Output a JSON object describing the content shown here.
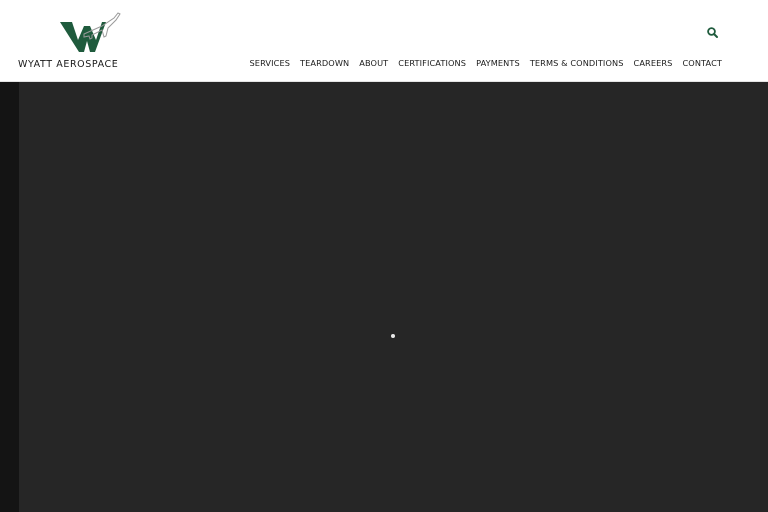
{
  "brand": {
    "name": "WYATT AEROSPACE",
    "logo_letter": "W",
    "logo_color": "#1f5b3d"
  },
  "header": {
    "search_icon": "search-icon"
  },
  "nav": {
    "items": [
      {
        "label": "SERVICES"
      },
      {
        "label": "TEARDOWN"
      },
      {
        "label": "ABOUT"
      },
      {
        "label": "CERTIFICATIONS"
      },
      {
        "label": "PAYMENTS"
      },
      {
        "label": "TERMS & CONDITIONS"
      },
      {
        "label": "CAREERS"
      },
      {
        "label": "CONTACT"
      }
    ]
  },
  "main": {
    "background": "#262626",
    "loader_icon": "loading-spinner-icon"
  }
}
